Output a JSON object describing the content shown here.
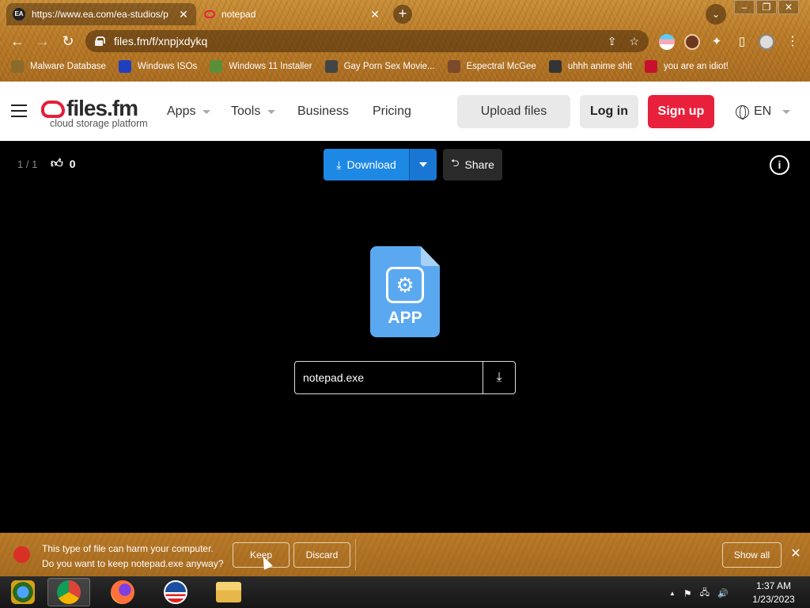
{
  "browser": {
    "tabs": [
      {
        "title": "https://www.ea.com/ea-studios/p",
        "active": true,
        "favicon": "ea-favicon",
        "close": "✕"
      },
      {
        "title": "notepad",
        "active": false,
        "favicon": "filesfm-favicon",
        "close": "✕"
      }
    ],
    "new_tab": "+",
    "tab_search": "⌄",
    "window_controls": {
      "minimize": "–",
      "restore": "❐",
      "close": "✕"
    },
    "nav": {
      "back": "←",
      "forward": "→",
      "reload": "↻"
    },
    "url": "files.fm/f/xnpjxdykq",
    "omnibox_icons": {
      "share": "⇪",
      "bookmark": "☆"
    },
    "toolbar_icons": {
      "extensions": "✦",
      "sidepanel": "▯",
      "menu": "⋮"
    },
    "bookmarks": [
      {
        "label": "Malware Database",
        "icon": "malware-db-icon",
        "color": "#8b6b2a"
      },
      {
        "label": "Windows ISOs",
        "icon": "windows-iso-icon",
        "color": "#1f3fbf"
      },
      {
        "label": "Windows 11 Installer",
        "icon": "installer-icon",
        "color": "#5a8f3a"
      },
      {
        "label": "Gay Porn Sex Movie...",
        "icon": "site-icon",
        "color": "#444444"
      },
      {
        "label": "Espectral McGee",
        "icon": "espectral-icon",
        "color": "#7a4a2a"
      },
      {
        "label": "uhhh anime shit",
        "icon": "anime-icon",
        "color": "#333333"
      },
      {
        "label": "you are an idiot!",
        "icon": "uk-flag-icon",
        "color": "#c8102e"
      }
    ]
  },
  "site": {
    "brand": "files.fm",
    "tagline": "cloud storage platform",
    "nav": {
      "apps": "Apps",
      "tools": "Tools",
      "business": "Business",
      "pricing": "Pricing"
    },
    "upload": "Upload files",
    "login": "Log in",
    "signup": "Sign up",
    "language": "EN",
    "accent_red": "#e8203b",
    "accent_blue": "#1e88e5"
  },
  "viewer": {
    "counter": "1 / 1",
    "likes": "0",
    "download": "Download",
    "share": "Share",
    "info": "i",
    "file_type": "APP",
    "file_name": "notepad.exe",
    "download_arrow": "⤓"
  },
  "download_bar": {
    "line1": "This type of file can harm your computer.",
    "line2": "Do you want to keep notepad.exe anyway?",
    "keep": "Keep",
    "discard": "Discard",
    "show_all": "Show all",
    "close": "✕"
  },
  "taskbar": {
    "apps": [
      "media-center-icon",
      "chrome-icon",
      "firefox-icon",
      "obama-logo-icon",
      "file-explorer-icon"
    ],
    "tray": {
      "chevron": "▲",
      "flag": "⚑",
      "network": "🖧",
      "volume": "🔊"
    },
    "time": "1:37 AM",
    "date": "1/23/2023"
  }
}
